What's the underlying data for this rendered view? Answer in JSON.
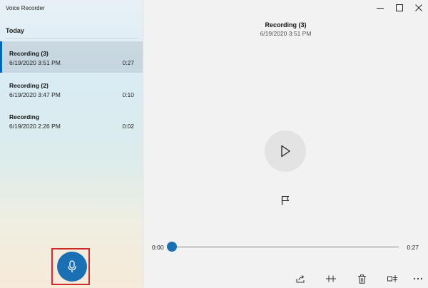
{
  "window": {
    "title": "Voice Recorder"
  },
  "sidebar": {
    "group_header": "Today",
    "recordings": [
      {
        "name": "Recording (3)",
        "date": "6/19/2020 3:51 PM",
        "duration": "0:27",
        "selected": true
      },
      {
        "name": "Recording (2)",
        "date": "6/19/2020 3:47 PM",
        "duration": "0:10",
        "selected": false
      },
      {
        "name": "Recording",
        "date": "6/19/2020 2:26 PM",
        "duration": "0:02",
        "selected": false
      }
    ],
    "record_icon": "microphone-icon",
    "highlight_color": "#d22a2a"
  },
  "player": {
    "title": "Recording (3)",
    "date": "6/19/2020 3:51 PM",
    "elapsed": "0:00",
    "total": "0:27",
    "progress": 0
  },
  "toolbar": {
    "icons": [
      "share-icon",
      "trim-icon",
      "delete-icon",
      "rename-icon",
      "more-icon"
    ]
  },
  "colors": {
    "accent": "#1b6fb3",
    "selection": "#0067c0"
  }
}
